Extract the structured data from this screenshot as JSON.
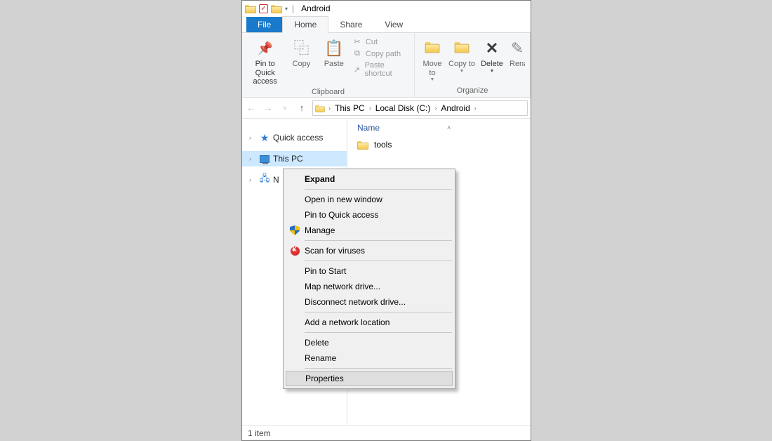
{
  "titlebar": {
    "title": "Android"
  },
  "tabs": {
    "file": "File",
    "home": "Home",
    "share": "Share",
    "view": "View"
  },
  "ribbon": {
    "pin": "Pin to Quick access",
    "copy": "Copy",
    "paste": "Paste",
    "cut": "Cut",
    "copy_path": "Copy path",
    "paste_shortcut": "Paste shortcut",
    "clipboard_label": "Clipboard",
    "move_to": "Move to",
    "copy_to": "Copy to",
    "delete": "Delete",
    "rename": "Rename",
    "organize_label": "Organize"
  },
  "breadcrumb": {
    "items": [
      "This PC",
      "Local Disk (C:)",
      "Android"
    ]
  },
  "tree": {
    "quick_access": "Quick access",
    "this_pc": "This PC",
    "network_initial": "N"
  },
  "columns": {
    "name": "Name"
  },
  "files": {
    "item0": "tools"
  },
  "status": {
    "text": "1 item"
  },
  "ctx": {
    "expand": "Expand",
    "open_new": "Open in new window",
    "pin_qa": "Pin to Quick access",
    "manage": "Manage",
    "scan": "Scan for viruses",
    "pin_start": "Pin to Start",
    "map_drive": "Map network drive...",
    "disc_drive": "Disconnect network drive...",
    "add_loc": "Add a network location",
    "delete": "Delete",
    "rename": "Rename",
    "properties": "Properties"
  }
}
